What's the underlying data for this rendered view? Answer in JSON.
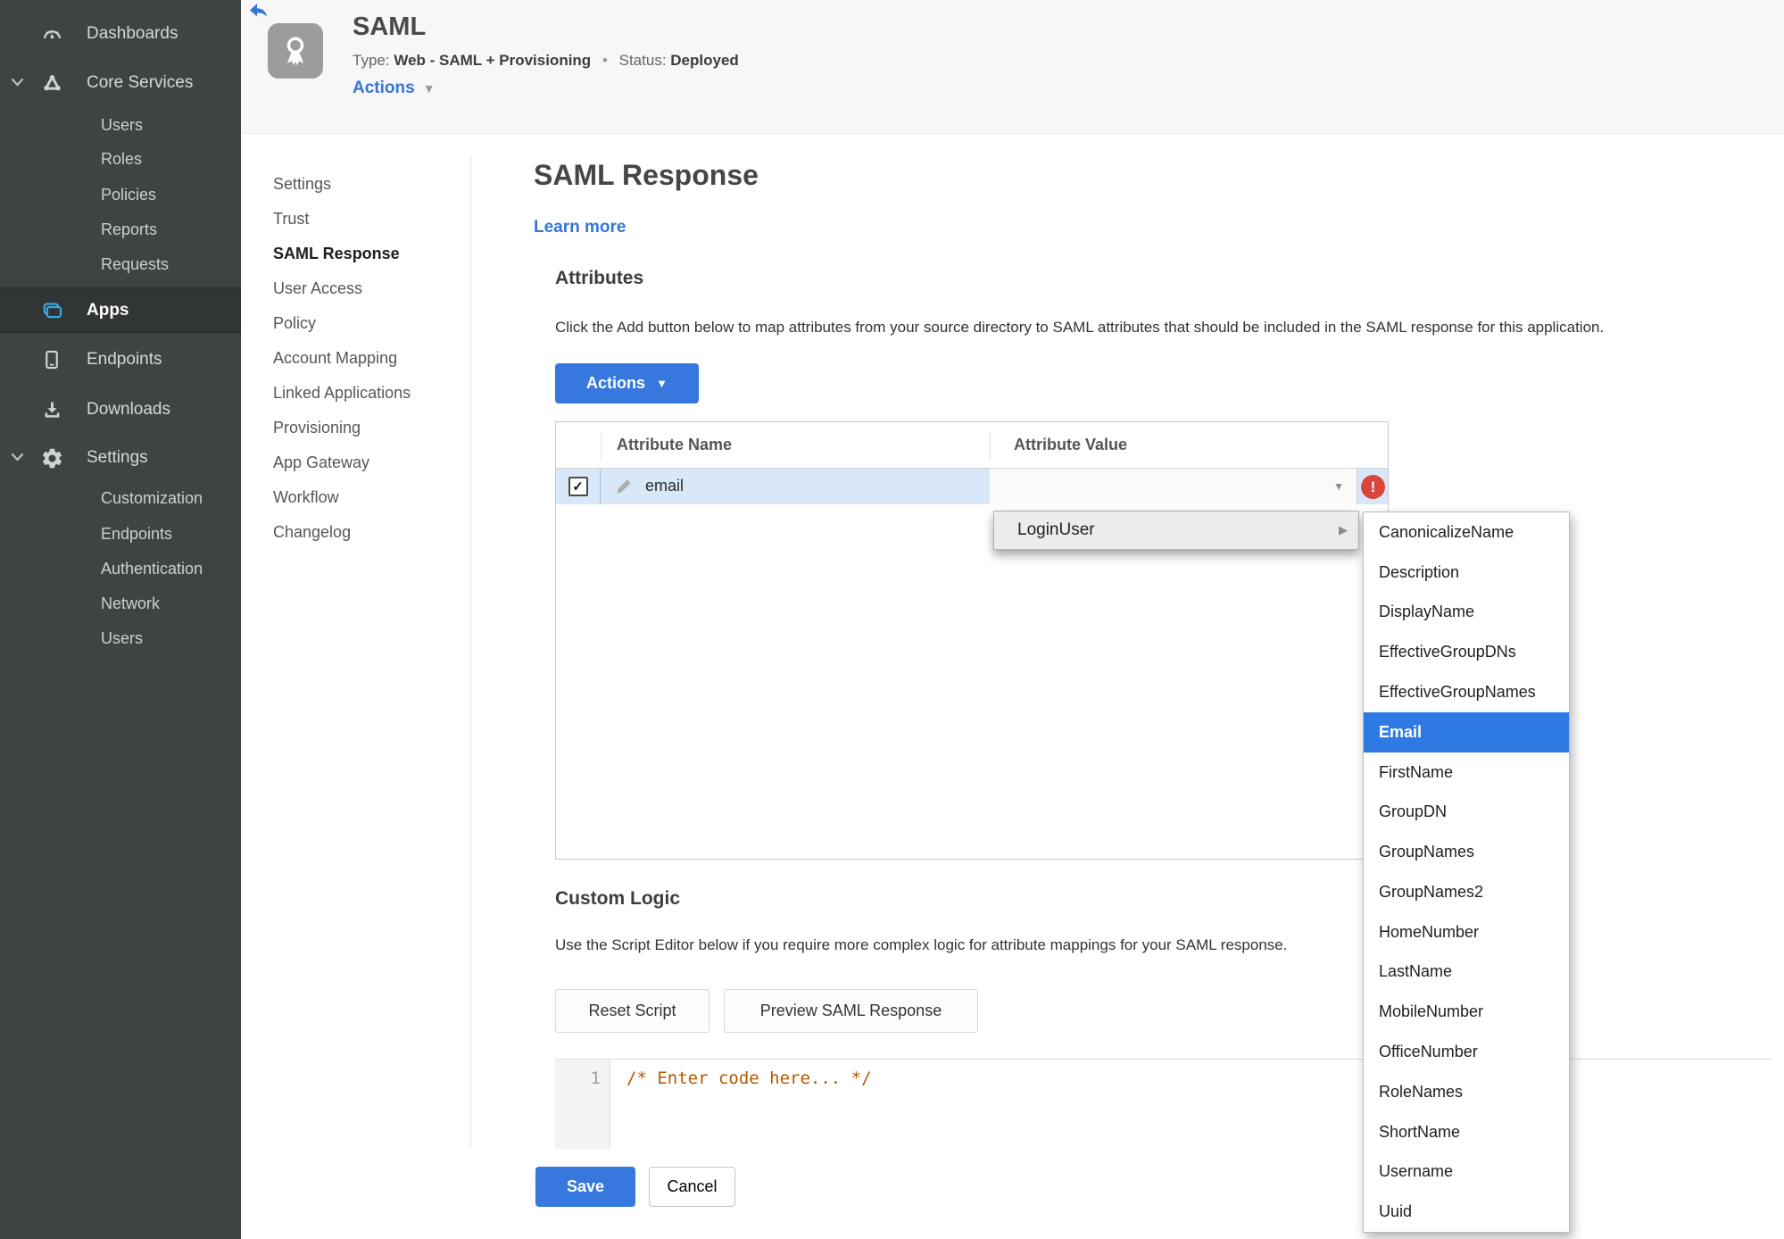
{
  "sidebar": {
    "dashboards": "Dashboards",
    "core_services": "Core Services",
    "core_children": [
      "Users",
      "Roles",
      "Policies",
      "Reports",
      "Requests"
    ],
    "apps": "Apps",
    "endpoints": "Endpoints",
    "downloads": "Downloads",
    "settings": "Settings",
    "settings_children": [
      "Customization",
      "Endpoints",
      "Authentication",
      "Network",
      "Users"
    ]
  },
  "header": {
    "app_title": "SAML",
    "type_label": "Type:",
    "type_value": "Web - SAML + Provisioning",
    "separator": "•",
    "status_label": "Status:",
    "status_value": "Deployed",
    "actions_label": "Actions",
    "caret": "▼"
  },
  "subnav": {
    "items": [
      "Settings",
      "Trust",
      "SAML Response",
      "User Access",
      "Policy",
      "Account Mapping",
      "Linked Applications",
      "Provisioning",
      "App Gateway",
      "Workflow",
      "Changelog"
    ],
    "active": "SAML Response"
  },
  "main": {
    "title": "SAML Response",
    "learn_more": "Learn more",
    "attributes": {
      "heading": "Attributes",
      "description": "Click the Add button below to map attributes from your source directory to SAML attributes that should be included in the SAML response for this application.",
      "actions_button": "Actions",
      "table": {
        "columns": [
          "Attribute Name",
          "Attribute Value"
        ],
        "rows": [
          {
            "name": "email",
            "value": "",
            "checked": true,
            "checkmark": "✓",
            "error": true,
            "error_glyph": "!"
          }
        ]
      }
    },
    "value_menu": {
      "root_item": "LoginUser",
      "submenu_items": [
        "CanonicalizeName",
        "Description",
        "DisplayName",
        "EffectiveGroupDNs",
        "EffectiveGroupNames",
        "Email",
        "FirstName",
        "GroupDN",
        "GroupNames",
        "GroupNames2",
        "HomeNumber",
        "LastName",
        "MobileNumber",
        "OfficeNumber",
        "RoleNames",
        "ShortName",
        "Username",
        "Uuid"
      ],
      "selected_item": "Email"
    },
    "custom_logic": {
      "heading": "Custom Logic",
      "description": "Use the Script Editor below if you require more complex logic for attribute mappings for your SAML response.",
      "reset_button": "Reset Script",
      "preview_button": "Preview SAML Response",
      "editor": {
        "line_number": "1",
        "code": "/* Enter code here... */"
      }
    },
    "footer": {
      "save_label": "Save",
      "cancel_label": "Cancel"
    }
  },
  "icons": {
    "back": "back-arrow-icon",
    "badge": "award-ribbon-icon",
    "row_edit": "pencil-icon",
    "row_error": "error-exclamation-icon",
    "sidebar": [
      "gauge-icon",
      "core-services-icon",
      "apps-icon",
      "device-icon",
      "download-icon",
      "gear-icon"
    ]
  },
  "colors": {
    "accent_blue": "#3678dd",
    "link_blue": "#3576d4",
    "selection_blue": "#2e7ae2",
    "row_highlight": "#d9e8f9",
    "status_green": "#3e9e27",
    "error_red": "#d9453a",
    "code_comment": "#b25900",
    "sidebar_bg": "#3f4344",
    "header_bg": "#f7f7f7",
    "apps_icon_blue": "#3aa9e0"
  }
}
